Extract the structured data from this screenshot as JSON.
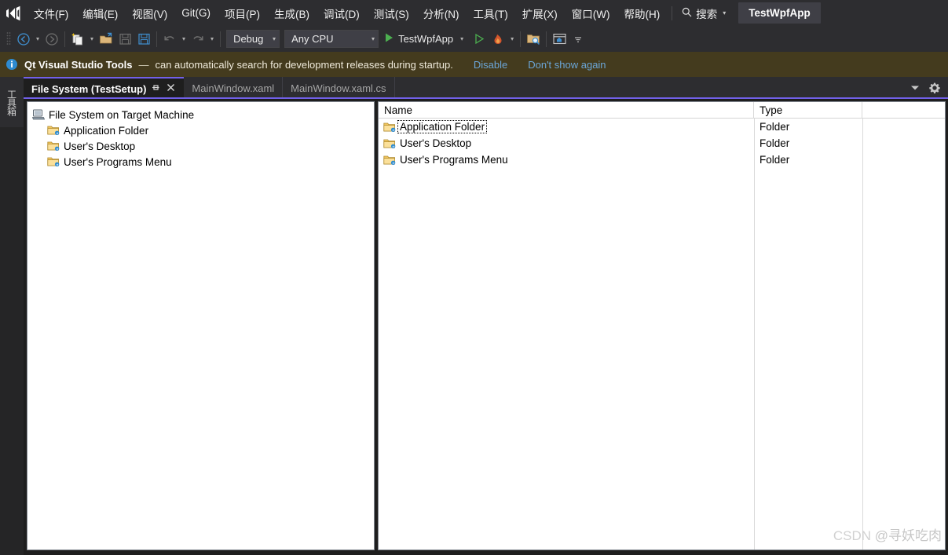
{
  "app": {
    "title": "TestWpfApp",
    "accent_color": "#7160e8",
    "chrome_bg": "#2d2d30"
  },
  "menubar": {
    "logo_icon": "visual-studio-logo-icon",
    "items": [
      {
        "label": "文件(F)"
      },
      {
        "label": "编辑(E)"
      },
      {
        "label": "视图(V)"
      },
      {
        "label": "Git(G)"
      },
      {
        "label": "项目(P)"
      },
      {
        "label": "生成(B)"
      },
      {
        "label": "调试(D)"
      },
      {
        "label": "测试(S)"
      },
      {
        "label": "分析(N)"
      },
      {
        "label": "工具(T)"
      },
      {
        "label": "扩展(X)"
      },
      {
        "label": "窗口(W)"
      },
      {
        "label": "帮助(H)"
      }
    ],
    "search": {
      "icon": "search-icon",
      "label": "搜索",
      "caret": "▾"
    },
    "project_badge": "TestWpfApp"
  },
  "toolbar": {
    "back_icon": "navigate-back-icon",
    "forward_icon": "navigate-forward-icon",
    "new_project_icon": "new-project-icon",
    "open_file_icon": "open-file-icon",
    "save_icon": "save-icon",
    "save_all_icon": "save-all-icon",
    "undo_icon": "undo-icon",
    "redo_icon": "redo-icon",
    "configuration": {
      "value": "Debug",
      "caret": "▾"
    },
    "platform": {
      "value": "Any CPU",
      "caret": "▾"
    },
    "start_label": "TestWpfApp",
    "start_icon": "play-icon",
    "start_caret": "▾",
    "start_without_debug_icon": "play-outline-icon",
    "hot_reload_icon": "hot-reload-icon",
    "hot_reload_caret": "▾",
    "find_in_files_icon": "folder-search-icon",
    "window_layout_icon": "window-home-icon",
    "overflow_icon": "toolbar-overflow-icon"
  },
  "notification": {
    "icon": "info-icon",
    "title": "Qt Visual Studio Tools",
    "dash": "—",
    "message": "can automatically search for development releases during startup.",
    "links": [
      "Disable",
      "Don't show again"
    ],
    "bg_color": "#443b1e",
    "link_color": "#6ba6d8"
  },
  "toolbox": {
    "label": "工具箱"
  },
  "tabs": {
    "items": [
      {
        "label": "File System (TestSetup)",
        "active": true,
        "pin_icon": "pin-icon",
        "close_icon": "close-icon"
      },
      {
        "label": "MainWindow.xaml",
        "active": false
      },
      {
        "label": "MainWindow.xaml.cs",
        "active": false
      }
    ],
    "overflow_icon": "chevron-down-icon",
    "settings_icon": "gear-icon"
  },
  "file_system_editor": {
    "tree": {
      "root": {
        "label": "File System on Target Machine",
        "icon": "computer-icon"
      },
      "children": [
        {
          "label": "Application Folder",
          "icon": "folder-shortcut-icon"
        },
        {
          "label": "User's Desktop",
          "icon": "folder-shortcut-icon"
        },
        {
          "label": "User's Programs Menu",
          "icon": "folder-shortcut-icon"
        }
      ]
    },
    "list": {
      "columns": [
        "Name",
        "Type"
      ],
      "rows": [
        {
          "name": "Application Folder",
          "type": "Folder",
          "icon": "folder-shortcut-icon",
          "focused": true
        },
        {
          "name": "User's Desktop",
          "type": "Folder",
          "icon": "folder-shortcut-icon",
          "focused": false
        },
        {
          "name": "User's Programs Menu",
          "type": "Folder",
          "icon": "folder-shortcut-icon",
          "focused": false
        }
      ]
    }
  },
  "watermark": {
    "brand": "CSDN",
    "author": "@寻妖吃肉"
  }
}
